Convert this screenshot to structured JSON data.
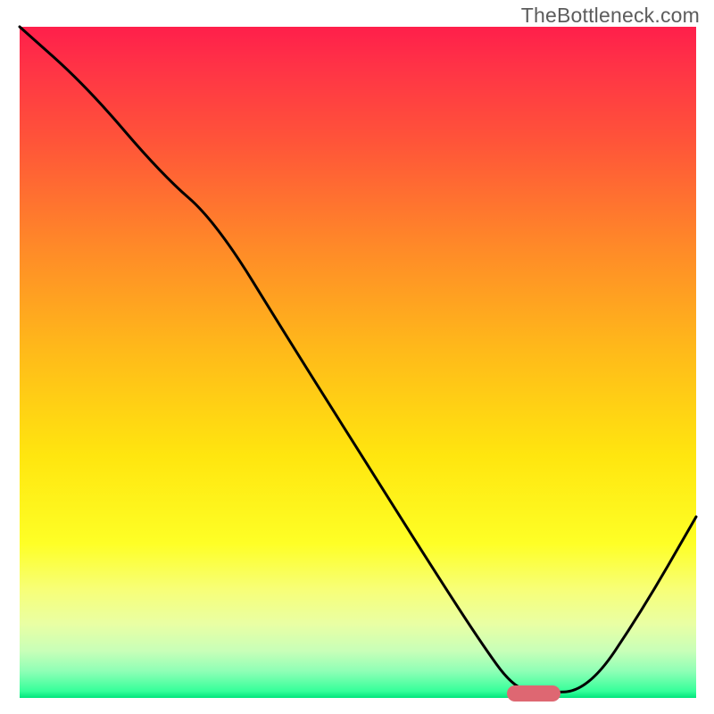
{
  "watermark": "TheBottleneck.com",
  "chart_data": {
    "type": "line",
    "title": "",
    "xlabel": "",
    "ylabel": "",
    "xlim": [
      0,
      100
    ],
    "ylim": [
      0,
      100
    ],
    "series": [
      {
        "name": "curve",
        "x": [
          0,
          10,
          21,
          29,
          40,
          50,
          60,
          68,
          73,
          77,
          84,
          92,
          100
        ],
        "y": [
          100,
          91,
          78,
          71,
          53,
          37,
          21,
          8.5,
          1.5,
          0.8,
          1,
          13,
          27
        ]
      }
    ],
    "marker": {
      "x_start": 72,
      "x_end": 80,
      "y": 0.7
    },
    "gradient_stops": [
      {
        "pos": 0,
        "color": "#ff1f4b"
      },
      {
        "pos": 6,
        "color": "#ff3346"
      },
      {
        "pos": 17,
        "color": "#ff5439"
      },
      {
        "pos": 33,
        "color": "#ff8a28"
      },
      {
        "pos": 48,
        "color": "#ffb91a"
      },
      {
        "pos": 64,
        "color": "#ffe60f"
      },
      {
        "pos": 77,
        "color": "#feff26"
      },
      {
        "pos": 84,
        "color": "#f7ff79"
      },
      {
        "pos": 89,
        "color": "#e9ffa4"
      },
      {
        "pos": 93,
        "color": "#c8ffb8"
      },
      {
        "pos": 96,
        "color": "#8fffb6"
      },
      {
        "pos": 99,
        "color": "#35ff9a"
      },
      {
        "pos": 100,
        "color": "#00e57c"
      }
    ]
  }
}
